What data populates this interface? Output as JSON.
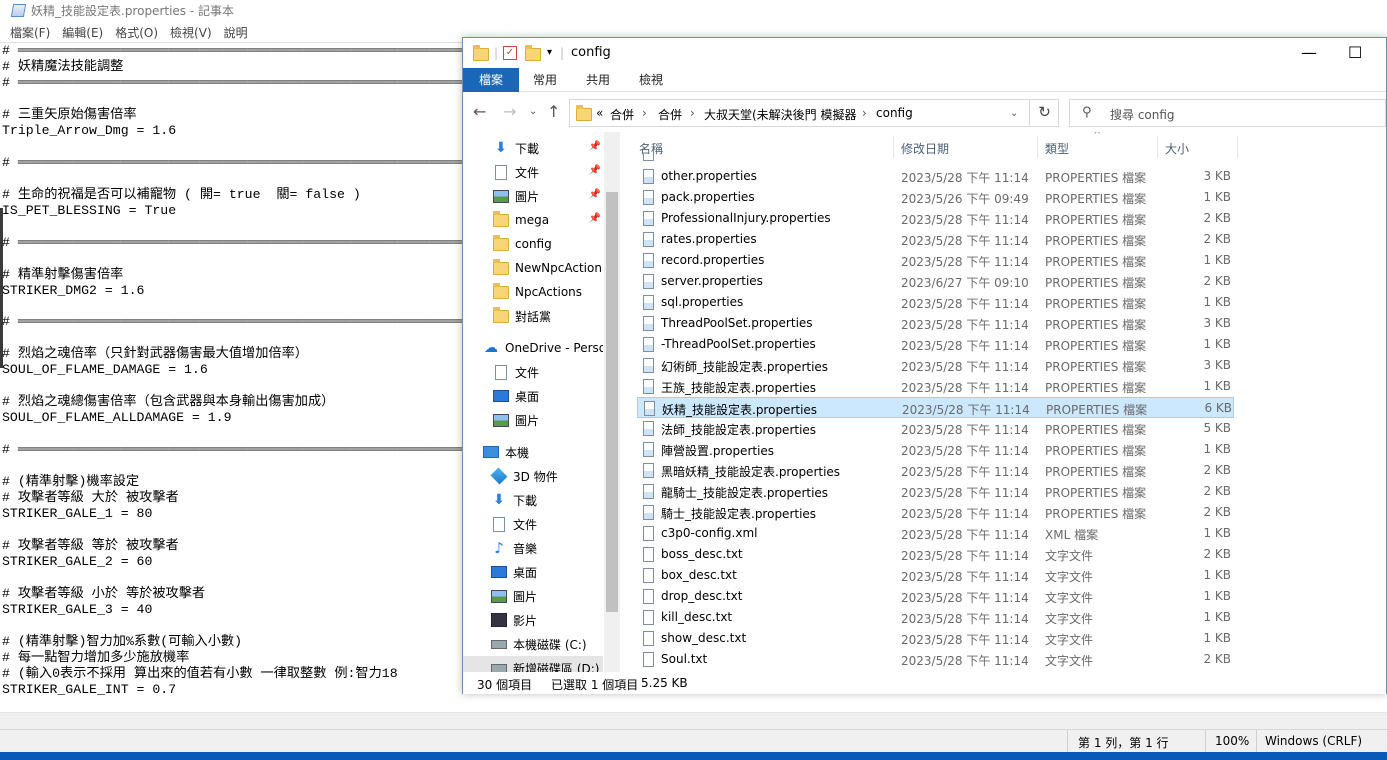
{
  "notepad": {
    "title": "妖精_技能設定表.properties - 記事本",
    "menu": [
      "檔案(F)",
      "編輯(E)",
      "格式(O)",
      "檢視(V)",
      "說明"
    ],
    "lines": [
      "# ══════════════════════════════════════════════════════════════════════════",
      "# 妖精魔法技能調整",
      "# ══════════════════════════════════════════════════════════════════════════",
      "",
      "# 三重矢原始傷害倍率",
      "Triple_Arrow_Dmg = 1.6",
      "",
      "# ══════════════════════════════════════════════════════════════════════════",
      "",
      "# 生命的祝福是否可以補寵物 ( 開= true  關= false )",
      "IS_PET_BLESSING = True",
      "",
      "# ══════════════════════════════════════════════════════════════════════════",
      "",
      "# 精準射擊傷害倍率",
      "STRIKER_DMG2 = 1.6",
      "",
      "# ══════════════════════════════════════════════════════════════════════════",
      "",
      "# 烈焰之魂倍率（只針對武器傷害最大值增加倍率）",
      "SOUL_OF_FLAME_DAMAGE = 1.6",
      "",
      "# 烈焰之魂總傷害倍率（包含武器與本身輸出傷害加成）",
      "SOUL_OF_FLAME_ALLDAMAGE = 1.9",
      "",
      "# ══════════════════════════════════════════════════════════════════════════",
      "",
      "# (精準射擊)機率設定",
      "# 攻擊者等級 大於 被攻擊者",
      "STRIKER_GALE_1 = 80",
      "",
      "# 攻擊者等級 等於 被攻擊者",
      "STRIKER_GALE_2 = 60",
      "",
      "# 攻擊者等級 小於 等於被攻擊者",
      "STRIKER_GALE_3 = 40",
      "",
      "# (精準射擊)智力加%系數(可輸入小數)",
      "# 每一點智力增加多少施放機率",
      "# (輸入0表示不採用 算出來的值若有小數 一律取整數 例:智力18",
      "STRIKER_GALE_INT = 0.7"
    ],
    "status": {
      "position": "第 1 列，第 1 行",
      "zoom": "100%",
      "encoding": "Windows (CRLF)"
    }
  },
  "explorer": {
    "title": "config",
    "ribbon_tabs": [
      "檔案",
      "常用",
      "共用",
      "檢視"
    ],
    "window_controls": {
      "minimize": "—",
      "maximize": "☐"
    },
    "breadcrumb": [
      "«",
      "合併",
      "›",
      "合併",
      "›",
      "大叔天堂(未解決後門 模擬器",
      "›",
      "config"
    ],
    "search_placeholder": "搜尋 config",
    "columns": {
      "name": "名稱",
      "date": "修改日期",
      "type": "類型",
      "size": "大小"
    },
    "nav_items": [
      {
        "label": "下載",
        "icon": "download-icon",
        "pinned": true
      },
      {
        "label": "文件",
        "icon": "document-icon",
        "pinned": true
      },
      {
        "label": "圖片",
        "icon": "picture-icon",
        "pinned": true
      },
      {
        "label": "mega",
        "icon": "folder-icon",
        "pinned": true
      },
      {
        "label": "config",
        "icon": "folder-icon",
        "pinned": false
      },
      {
        "label": "NewNpcAction",
        "icon": "folder-icon",
        "pinned": false
      },
      {
        "label": "NpcActions",
        "icon": "folder-icon",
        "pinned": false
      },
      {
        "label": "對話黨",
        "icon": "folder-icon",
        "pinned": false
      },
      {
        "label": "OneDrive - Perso",
        "icon": "cloud-icon",
        "pinned": false
      },
      {
        "label": "文件",
        "icon": "document-icon",
        "pinned": false
      },
      {
        "label": "桌面",
        "icon": "desktop-icon",
        "pinned": false
      },
      {
        "label": "圖片",
        "icon": "picture-icon",
        "pinned": false
      },
      {
        "label": "本機",
        "icon": "pc-icon",
        "pinned": false
      },
      {
        "label": "3D 物件",
        "icon": "3d-objects-icon",
        "pinned": false
      },
      {
        "label": "下載",
        "icon": "download-icon",
        "pinned": false
      },
      {
        "label": "文件",
        "icon": "document-icon",
        "pinned": false
      },
      {
        "label": "音樂",
        "icon": "music-icon",
        "pinned": false
      },
      {
        "label": "桌面",
        "icon": "desktop-icon",
        "pinned": false
      },
      {
        "label": "圖片",
        "icon": "picture-icon",
        "pinned": false
      },
      {
        "label": "影片",
        "icon": "video-icon",
        "pinned": false
      },
      {
        "label": "本機磁碟 (C:)",
        "icon": "drive-icon",
        "pinned": false
      },
      {
        "label": "新增磁碟區 (D:)",
        "icon": "drive-icon",
        "pinned": false
      }
    ],
    "files": [
      {
        "name": "other.properties",
        "date": "2023/5/28 下午 11:14",
        "type": "PROPERTIES 檔案",
        "size": "3 KB",
        "selected": false
      },
      {
        "name": "pack.properties",
        "date": "2023/5/26 下午 09:49",
        "type": "PROPERTIES 檔案",
        "size": "1 KB",
        "selected": false
      },
      {
        "name": "ProfessionalInjury.properties",
        "date": "2023/5/28 下午 11:14",
        "type": "PROPERTIES 檔案",
        "size": "2 KB",
        "selected": false
      },
      {
        "name": "rates.properties",
        "date": "2023/5/28 下午 11:14",
        "type": "PROPERTIES 檔案",
        "size": "2 KB",
        "selected": false
      },
      {
        "name": "record.properties",
        "date": "2023/5/28 下午 11:14",
        "type": "PROPERTIES 檔案",
        "size": "1 KB",
        "selected": false
      },
      {
        "name": "server.properties",
        "date": "2023/6/27 下午 09:10",
        "type": "PROPERTIES 檔案",
        "size": "2 KB",
        "selected": false
      },
      {
        "name": "sql.properties",
        "date": "2023/5/28 下午 11:14",
        "type": "PROPERTIES 檔案",
        "size": "1 KB",
        "selected": false
      },
      {
        "name": "ThreadPoolSet.properties",
        "date": "2023/5/28 下午 11:14",
        "type": "PROPERTIES 檔案",
        "size": "3 KB",
        "selected": false
      },
      {
        "name": "-ThreadPoolSet.properties",
        "date": "2023/5/28 下午 11:14",
        "type": "PROPERTIES 檔案",
        "size": "1 KB",
        "selected": false
      },
      {
        "name": "幻術師_技能設定表.properties",
        "date": "2023/5/28 下午 11:14",
        "type": "PROPERTIES 檔案",
        "size": "3 KB",
        "selected": false
      },
      {
        "name": "王族_技能設定表.properties",
        "date": "2023/5/28 下午 11:14",
        "type": "PROPERTIES 檔案",
        "size": "1 KB",
        "selected": false
      },
      {
        "name": "妖精_技能設定表.properties",
        "date": "2023/5/28 下午 11:14",
        "type": "PROPERTIES 檔案",
        "size": "6 KB",
        "selected": true
      },
      {
        "name": "法師_技能設定表.properties",
        "date": "2023/5/28 下午 11:14",
        "type": "PROPERTIES 檔案",
        "size": "5 KB",
        "selected": false
      },
      {
        "name": "陣營設置.properties",
        "date": "2023/5/28 下午 11:14",
        "type": "PROPERTIES 檔案",
        "size": "1 KB",
        "selected": false
      },
      {
        "name": "黑暗妖精_技能設定表.properties",
        "date": "2023/5/28 下午 11:14",
        "type": "PROPERTIES 檔案",
        "size": "2 KB",
        "selected": false
      },
      {
        "name": "龍騎士_技能設定表.properties",
        "date": "2023/5/28 下午 11:14",
        "type": "PROPERTIES 檔案",
        "size": "2 KB",
        "selected": false
      },
      {
        "name": "騎士_技能設定表.properties",
        "date": "2023/5/28 下午 11:14",
        "type": "PROPERTIES 檔案",
        "size": "2 KB",
        "selected": false
      },
      {
        "name": "c3p0-config.xml",
        "date": "2023/5/28 下午 11:14",
        "type": "XML 檔案",
        "size": "1 KB",
        "selected": false
      },
      {
        "name": "boss_desc.txt",
        "date": "2023/5/28 下午 11:14",
        "type": "文字文件",
        "size": "2 KB",
        "selected": false
      },
      {
        "name": "box_desc.txt",
        "date": "2023/5/28 下午 11:14",
        "type": "文字文件",
        "size": "1 KB",
        "selected": false
      },
      {
        "name": "drop_desc.txt",
        "date": "2023/5/28 下午 11:14",
        "type": "文字文件",
        "size": "1 KB",
        "selected": false
      },
      {
        "name": "kill_desc.txt",
        "date": "2023/5/28 下午 11:14",
        "type": "文字文件",
        "size": "1 KB",
        "selected": false
      },
      {
        "name": "show_desc.txt",
        "date": "2023/5/28 下午 11:14",
        "type": "文字文件",
        "size": "1 KB",
        "selected": false
      },
      {
        "name": "Soul.txt",
        "date": "2023/5/28 下午 11:14",
        "type": "文字文件",
        "size": "2 KB",
        "selected": false
      }
    ],
    "status": {
      "item_count": "30 個項目",
      "selected": "已選取 1 個項目",
      "selected_size": "5.25 KB"
    }
  }
}
